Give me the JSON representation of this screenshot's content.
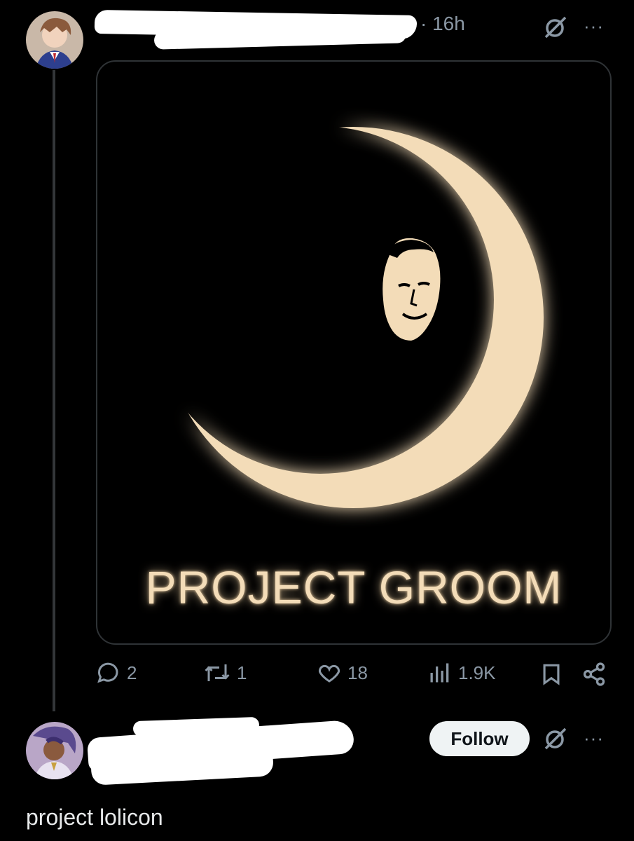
{
  "post": {
    "time": "· 16h",
    "more_label": "···",
    "media": {
      "title": "PROJECT GROOM"
    },
    "actions": {
      "replies": "2",
      "reposts": "1",
      "likes": "18",
      "views": "1.9K"
    }
  },
  "reply": {
    "follow_label": "Follow",
    "more_label": "···",
    "text": "project lolicon"
  },
  "colors": {
    "background": "#000000",
    "muted": "#8b98a5",
    "moon": "#f3dcb8",
    "follow_bg": "#eff3f4"
  },
  "icons": [
    "avatar",
    "grok-icon",
    "more-icon",
    "reply-icon",
    "repost-icon",
    "like-icon",
    "views-icon",
    "bookmark-icon",
    "share-icon"
  ]
}
